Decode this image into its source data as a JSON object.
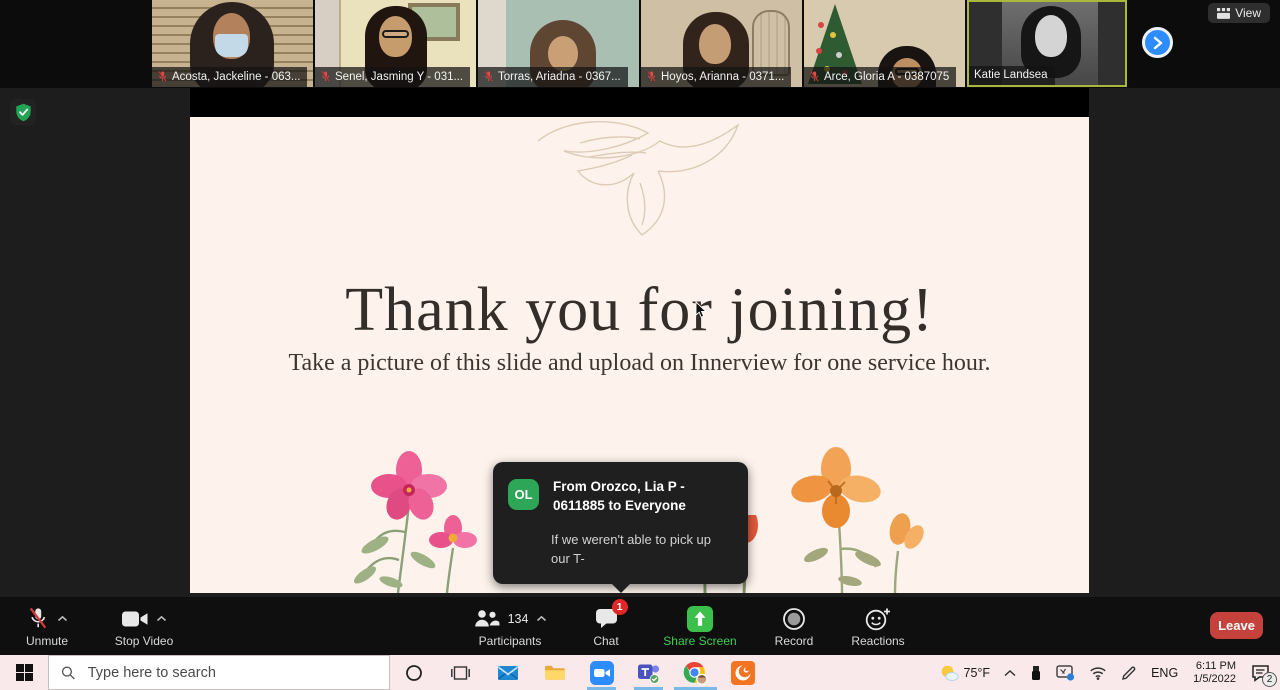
{
  "meeting": {
    "view_label": "View",
    "participants": [
      {
        "name": "Acosta, Jackeline - 063...",
        "muted": true
      },
      {
        "name": "Senel, Jasming Y - 031...",
        "muted": true
      },
      {
        "name": "Torras, Ariadna - 0367...",
        "muted": true
      },
      {
        "name": "Hoyos, Arianna - 0371...",
        "muted": true
      },
      {
        "name": "Arce, Gloria A - 0387075",
        "muted": true
      },
      {
        "name": "Katie Landsea",
        "muted": false,
        "active_speaker": true
      }
    ]
  },
  "slide": {
    "title": "Thank you for joining!",
    "subtitle": "Take a picture of this slide and upload on Innerview for one service hour."
  },
  "chat_popup": {
    "avatar_initials": "OL",
    "header": "From Orozco, Lia P - 0611885 to Everyone",
    "message": "If we weren't able to pick up our T-"
  },
  "toolbar": {
    "unmute_label": "Unmute",
    "stop_video_label": "Stop Video",
    "participants_label": "Participants",
    "participants_count": "134",
    "chat_label": "Chat",
    "chat_badge": "1",
    "share_screen_label": "Share Screen",
    "record_label": "Record",
    "reactions_label": "Reactions",
    "leave_label": "Leave"
  },
  "taskbar": {
    "search_placeholder": "Type here to search",
    "weather_temp": "75°F",
    "language": "ENG",
    "time": "6:11 PM",
    "date": "1/5/2022",
    "notification_count": "2"
  },
  "colors": {
    "accent_blue": "#2d8cff",
    "share_green": "#3dbf4c",
    "leave_red": "#c5423c",
    "badge_red": "#e02828",
    "active_speaker_border": "#aab73e",
    "slide_background": "#fdf3ec"
  }
}
